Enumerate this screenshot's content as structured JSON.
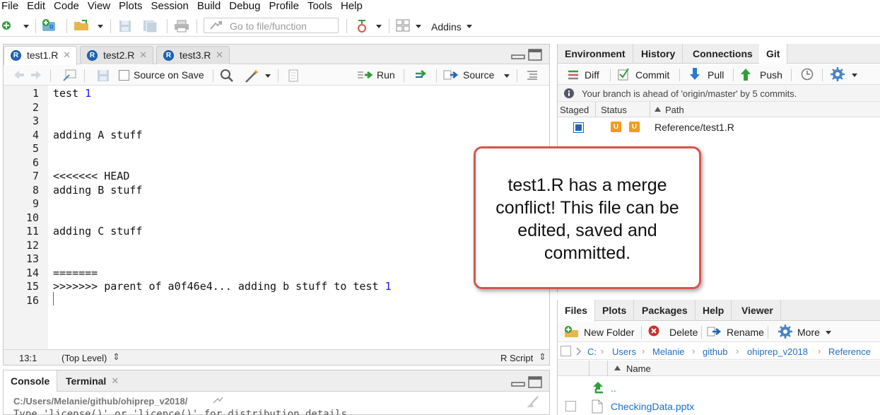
{
  "menu": [
    "File",
    "Edit",
    "Code",
    "View",
    "Plots",
    "Session",
    "Build",
    "Debug",
    "Profile",
    "Tools",
    "Help"
  ],
  "main_toolbar": {
    "goto_placeholder": "Go to file/function",
    "addins_label": "Addins"
  },
  "source": {
    "tabs": [
      {
        "label": "test1.R",
        "active": true
      },
      {
        "label": "test2.R",
        "active": false
      },
      {
        "label": "test3.R",
        "active": false
      }
    ],
    "toolbar": {
      "source_on_save": "Source on Save",
      "run": "Run",
      "source": "Source"
    },
    "lines": [
      {
        "n": "1",
        "text": "test ",
        "num": "1"
      },
      {
        "n": "2",
        "text": ""
      },
      {
        "n": "3",
        "text": ""
      },
      {
        "n": "4",
        "text": "adding A stuff"
      },
      {
        "n": "5",
        "text": ""
      },
      {
        "n": "6",
        "text": ""
      },
      {
        "n": "7",
        "text": "<<<<<<< HEAD"
      },
      {
        "n": "8",
        "text": "adding B stuff"
      },
      {
        "n": "9",
        "text": ""
      },
      {
        "n": "10",
        "text": ""
      },
      {
        "n": "11",
        "text": "adding C stuff"
      },
      {
        "n": "12",
        "text": ""
      },
      {
        "n": "13",
        "text": ""
      },
      {
        "n": "14",
        "text": "======="
      },
      {
        "n": "15",
        "text": ">>>>>>> parent of a0f46e4... adding b stuff to test ",
        "num": "1"
      },
      {
        "n": "16",
        "text": ""
      }
    ],
    "status": {
      "position": "13:1",
      "scope": "(Top Level)",
      "file_type": "R Script"
    }
  },
  "console": {
    "tabs": [
      "Console",
      "Terminal"
    ],
    "path": "C:/Users/Melanie/github/ohiprep_v2018/",
    "partial_line": "Type 'license()' or 'licence()' for distribution details."
  },
  "env_pane": {
    "tabs": [
      "Environment",
      "History",
      "Connections",
      "Git"
    ],
    "active_tab": "Git",
    "toolbar": {
      "diff": "Diff",
      "commit": "Commit",
      "pull": "Pull",
      "push": "Push"
    },
    "info": "Your branch is ahead of 'origin/master' by 5 commits.",
    "headers": {
      "staged": "Staged",
      "status": "Status",
      "path": "Path"
    },
    "rows": [
      {
        "status1": "U",
        "status2": "U",
        "path": "Reference/test1.R",
        "staged": true
      }
    ]
  },
  "files_pane": {
    "tabs": [
      "Files",
      "Plots",
      "Packages",
      "Help",
      "Viewer"
    ],
    "toolbar": {
      "new_folder": "New Folder",
      "delete": "Delete",
      "rename": "Rename",
      "more": "More"
    },
    "breadcrumb": [
      "C:",
      "Users",
      "Melanie",
      "github",
      "ohiprep_v2018",
      "Reference"
    ],
    "header_name": "Name",
    "rows": [
      {
        "name": ".."
      },
      {
        "name": "CheckingData.pptx"
      }
    ]
  },
  "callout": {
    "text": "test1.R has a merge conflict!  This file can be edited, saved and committed."
  },
  "colors": {
    "accent_red": "#d9534f",
    "link_blue": "#1f6fc3",
    "status_orange": "#f39b1b"
  }
}
